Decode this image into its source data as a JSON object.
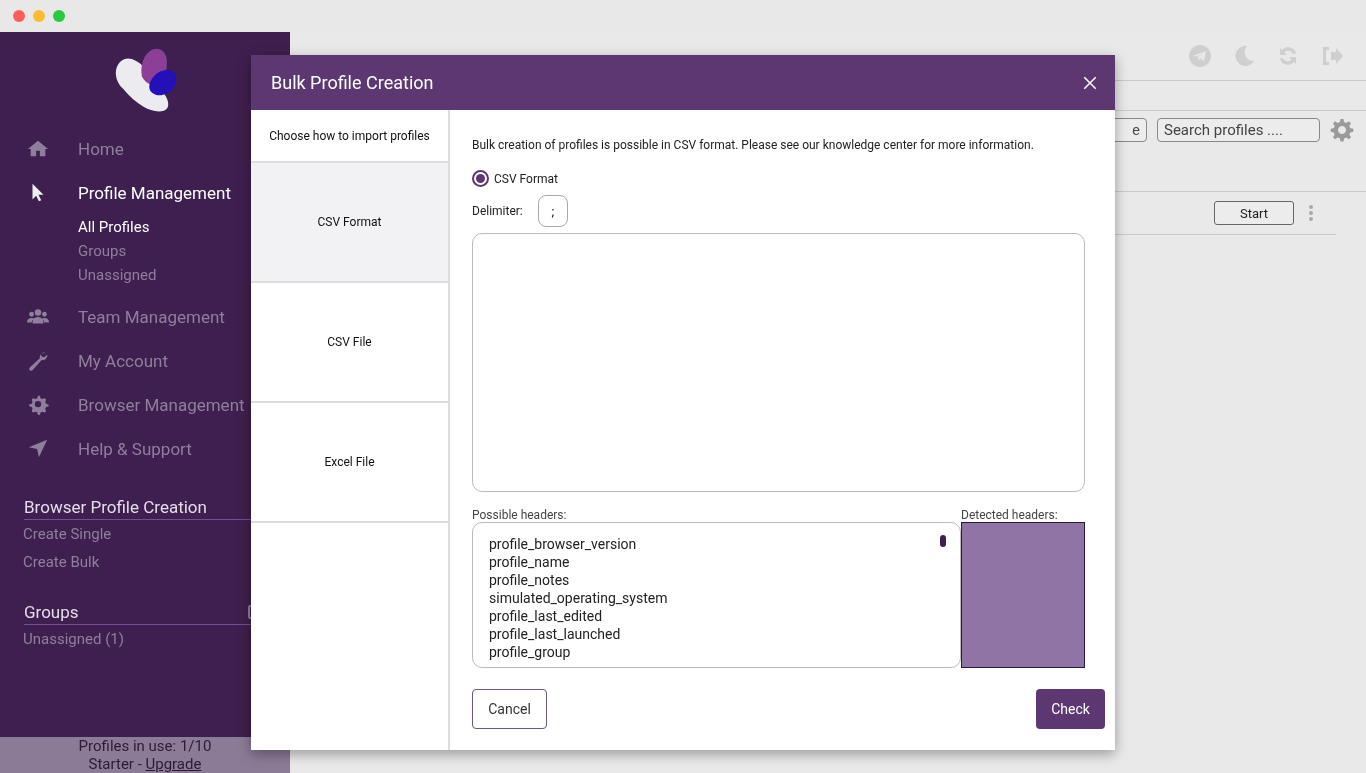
{
  "sidebar": {
    "nav": [
      {
        "label": "Home",
        "selected": false
      },
      {
        "label": "Profile Management",
        "selected": true,
        "children": [
          {
            "label": "All Profiles",
            "selected": true
          },
          {
            "label": "Groups",
            "selected": false
          },
          {
            "label": "Unassigned",
            "selected": false
          }
        ]
      },
      {
        "label": "Team Management",
        "selected": false
      },
      {
        "label": "My Account",
        "selected": false
      },
      {
        "label": "Browser Management",
        "selected": false
      },
      {
        "label": "Help & Support",
        "selected": false
      }
    ],
    "sections": [
      {
        "title": "Browser Profile Creation",
        "items": [
          "Create Single",
          "Create Bulk"
        ]
      },
      {
        "title": "Groups",
        "items": [
          "Unassigned (1)"
        ]
      }
    ],
    "footer": {
      "usage": "Profiles in use:  1/10",
      "plan": "Starter - ",
      "upgrade_link": "Upgrade"
    }
  },
  "main": {
    "toolbar": {
      "partial_button": "e",
      "search_placeholder": "Search profiles ...."
    },
    "row": {
      "start_button": "Start"
    }
  },
  "modal": {
    "title": "Bulk Profile Creation",
    "tabs_header": "Choose how to import profiles",
    "tabs": [
      {
        "label": "CSV Format",
        "selected": true
      },
      {
        "label": "CSV File",
        "selected": false
      },
      {
        "label": "Excel File",
        "selected": false
      }
    ],
    "intro": "Bulk creation of profiles is possible in CSV format. Please see our knowledge center for more information.",
    "format_radio": {
      "label": "CSV Format",
      "selected": true
    },
    "delimiter": {
      "label": "Delimiter:",
      "value": ";"
    },
    "possible_headers": {
      "label": "Possible headers:",
      "items": [
        "profile_browser_version",
        "profile_name",
        "profile_notes",
        "simulated_operating_system",
        "profile_last_edited",
        "profile_last_launched",
        "profile_group"
      ]
    },
    "detected_headers": {
      "label": "Detected headers:"
    },
    "cancel_button": "Cancel",
    "check_button": "Check"
  }
}
